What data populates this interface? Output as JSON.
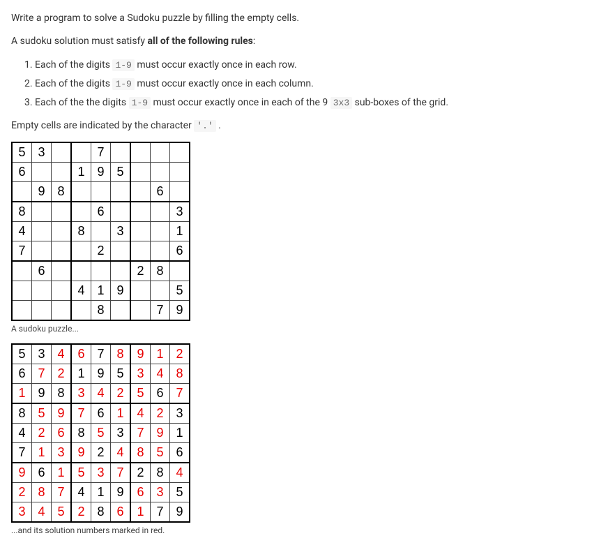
{
  "p_intro": "Write a program to solve a Sudoku puzzle by filling the empty cells.",
  "p_rules_pre": "A sudoku solution must satisfy ",
  "p_rules_bold": "all of the following rules",
  "p_rules_post": ":",
  "rule1_pre": "Each of the digits ",
  "rule1_code": "1-9",
  "rule1_post": " must occur exactly once in each row.",
  "rule2_pre": "Each of the digits ",
  "rule2_code": "1-9",
  "rule2_post": " must occur exactly once in each column.",
  "rule3_pre": "Each of the the digits ",
  "rule3_code": "1-9",
  "rule3_mid": " must occur exactly once in each of the 9 ",
  "rule3_code2": "3x3",
  "rule3_post": " sub-boxes of the grid.",
  "p_empty_pre": "Empty cells are indicated by the character ",
  "p_empty_code": "'.'",
  "p_empty_post": " .",
  "caption1": "A sudoku puzzle...",
  "caption2": "...and its solution numbers marked in red.",
  "puzzle": [
    [
      "5",
      "3",
      "",
      "",
      "7",
      "",
      "",
      "",
      ""
    ],
    [
      "6",
      "",
      "",
      "1",
      "9",
      "5",
      "",
      "",
      ""
    ],
    [
      "",
      "9",
      "8",
      "",
      "",
      "",
      "",
      "6",
      ""
    ],
    [
      "8",
      "",
      "",
      "",
      "6",
      "",
      "",
      "",
      "3"
    ],
    [
      "4",
      "",
      "",
      "8",
      "",
      "3",
      "",
      "",
      "1"
    ],
    [
      "7",
      "",
      "",
      "",
      "2",
      "",
      "",
      "",
      "6"
    ],
    [
      "",
      "6",
      "",
      "",
      "",
      "",
      "2",
      "8",
      ""
    ],
    [
      "",
      "",
      "",
      "4",
      "1",
      "9",
      "",
      "",
      "5"
    ],
    [
      "",
      "",
      "",
      "",
      "8",
      "",
      "",
      "7",
      "9"
    ]
  ],
  "solution": [
    [
      "5",
      "3",
      "4",
      "6",
      "7",
      "8",
      "9",
      "1",
      "2"
    ],
    [
      "6",
      "7",
      "2",
      "1",
      "9",
      "5",
      "3",
      "4",
      "8"
    ],
    [
      "1",
      "9",
      "8",
      "3",
      "4",
      "2",
      "5",
      "6",
      "7"
    ],
    [
      "8",
      "5",
      "9",
      "7",
      "6",
      "1",
      "4",
      "2",
      "3"
    ],
    [
      "4",
      "2",
      "6",
      "8",
      "5",
      "3",
      "7",
      "9",
      "1"
    ],
    [
      "7",
      "1",
      "3",
      "9",
      "2",
      "4",
      "8",
      "5",
      "6"
    ],
    [
      "9",
      "6",
      "1",
      "5",
      "3",
      "7",
      "2",
      "8",
      "4"
    ],
    [
      "2",
      "8",
      "7",
      "4",
      "1",
      "9",
      "6",
      "3",
      "5"
    ],
    [
      "3",
      "4",
      "5",
      "2",
      "8",
      "6",
      "1",
      "7",
      "9"
    ]
  ],
  "given_mask": [
    [
      1,
      1,
      0,
      0,
      1,
      0,
      0,
      0,
      0
    ],
    [
      1,
      0,
      0,
      1,
      1,
      1,
      0,
      0,
      0
    ],
    [
      0,
      1,
      1,
      0,
      0,
      0,
      0,
      1,
      0
    ],
    [
      1,
      0,
      0,
      0,
      1,
      0,
      0,
      0,
      1
    ],
    [
      1,
      0,
      0,
      1,
      0,
      1,
      0,
      0,
      1
    ],
    [
      1,
      0,
      0,
      0,
      1,
      0,
      0,
      0,
      1
    ],
    [
      0,
      1,
      0,
      0,
      0,
      0,
      1,
      1,
      0
    ],
    [
      0,
      0,
      0,
      1,
      1,
      1,
      0,
      0,
      1
    ],
    [
      0,
      0,
      0,
      0,
      1,
      0,
      0,
      1,
      1
    ]
  ]
}
